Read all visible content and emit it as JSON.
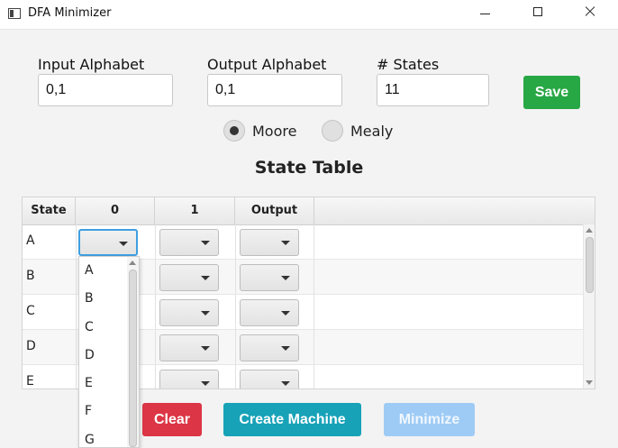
{
  "window": {
    "title": "DFA Minimizer"
  },
  "inputs": {
    "input_alphabet": {
      "label": "Input Alphabet",
      "value": "0,1"
    },
    "output_alphabet": {
      "label": "Output Alphabet",
      "value": "0,1"
    },
    "num_states": {
      "label": "# States",
      "value": "11"
    }
  },
  "buttons": {
    "save": "Save",
    "clear": "Clear",
    "create": "Create Machine",
    "minimize": "Minimize"
  },
  "machine_type": {
    "options": [
      "Moore",
      "Mealy"
    ],
    "selected": "Moore"
  },
  "table": {
    "title": "State Table",
    "columns": [
      "State",
      "0",
      "1",
      "Output"
    ],
    "rows": [
      "A",
      "B",
      "C",
      "D",
      "E"
    ]
  },
  "dropdown": {
    "open_row": "A",
    "open_column": "0",
    "options": [
      "A",
      "B",
      "C",
      "D",
      "E",
      "F",
      "G"
    ]
  },
  "colors": {
    "save": "#28a745",
    "clear": "#dc3545",
    "create": "#17a2b8",
    "minimize_disabled": "#9ecbf5"
  }
}
